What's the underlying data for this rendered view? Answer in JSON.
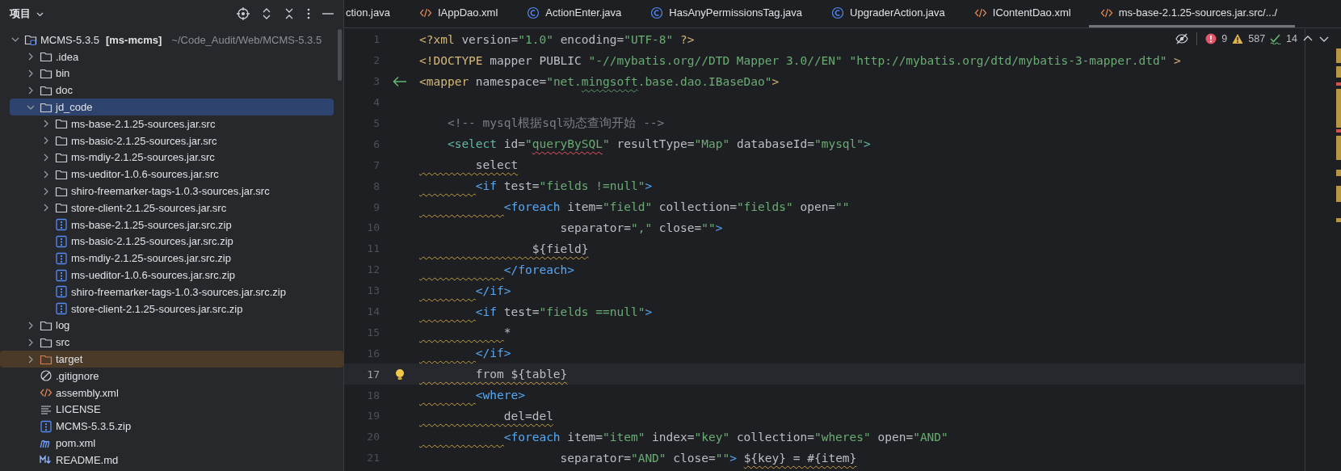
{
  "project": {
    "title": "项目",
    "tree": [
      {
        "kind": "module",
        "label": "MCMS-5.3.5",
        "suffix": "[ms-mcms]",
        "path": "~/Code_Audit/Web/MCMS-5.3.5",
        "expanded": true,
        "selected": false,
        "children": [
          {
            "kind": "folder",
            "label": ".idea",
            "expanded": false,
            "selected": false
          },
          {
            "kind": "folder",
            "label": "bin",
            "expanded": false,
            "selected": false
          },
          {
            "kind": "folder",
            "label": "doc",
            "expanded": false,
            "selected": false
          },
          {
            "kind": "folder",
            "label": "jd_code",
            "expanded": true,
            "selected": true,
            "children": [
              {
                "kind": "folder",
                "label": "ms-base-2.1.25-sources.jar.src",
                "expanded": false,
                "selected": false
              },
              {
                "kind": "folder",
                "label": "ms-basic-2.1.25-sources.jar.src",
                "expanded": false,
                "selected": false
              },
              {
                "kind": "folder",
                "label": "ms-mdiy-2.1.25-sources.jar.src",
                "expanded": false,
                "selected": false
              },
              {
                "kind": "folder",
                "label": "ms-ueditor-1.0.6-sources.jar.src",
                "expanded": false,
                "selected": false
              },
              {
                "kind": "folder",
                "label": "shiro-freemarker-tags-1.0.3-sources.jar.src",
                "expanded": false,
                "selected": false
              },
              {
                "kind": "folder",
                "label": "store-client-2.1.25-sources.jar.src",
                "expanded": false,
                "selected": false
              },
              {
                "kind": "zip",
                "label": "ms-base-2.1.25-sources.jar.src.zip",
                "selected": false
              },
              {
                "kind": "zip",
                "label": "ms-basic-2.1.25-sources.jar.src.zip",
                "selected": false
              },
              {
                "kind": "zip",
                "label": "ms-mdiy-2.1.25-sources.jar.src.zip",
                "selected": false
              },
              {
                "kind": "zip",
                "label": "ms-ueditor-1.0.6-sources.jar.src.zip",
                "selected": false
              },
              {
                "kind": "zip",
                "label": "shiro-freemarker-tags-1.0.3-sources.jar.src.zip",
                "selected": false
              },
              {
                "kind": "zip",
                "label": "store-client-2.1.25-sources.jar.src.zip",
                "selected": false
              }
            ]
          },
          {
            "kind": "folder",
            "label": "log",
            "expanded": false,
            "selected": false
          },
          {
            "kind": "folder",
            "label": "src",
            "expanded": false,
            "selected": false
          },
          {
            "kind": "excluded-folder",
            "label": "target",
            "expanded": false,
            "selected": false
          },
          {
            "kind": "ignore",
            "label": ".gitignore",
            "selected": false
          },
          {
            "kind": "xml",
            "label": "assembly.xml",
            "selected": false
          },
          {
            "kind": "text",
            "label": "LICENSE",
            "selected": false
          },
          {
            "kind": "zip",
            "label": "MCMS-5.3.5.zip",
            "selected": false
          },
          {
            "kind": "maven",
            "label": "pom.xml",
            "selected": false
          },
          {
            "kind": "markdown",
            "label": "README.md",
            "selected": false
          }
        ]
      }
    ]
  },
  "editor": {
    "tabs": [
      {
        "kind": "partial",
        "label": "ction.java",
        "selected": false
      },
      {
        "kind": "xml",
        "label": "IAppDao.xml",
        "selected": false
      },
      {
        "kind": "class",
        "label": "ActionEnter.java",
        "selected": false
      },
      {
        "kind": "class",
        "label": "HasAnyPermissionsTag.java",
        "selected": false
      },
      {
        "kind": "class",
        "label": "UpgraderAction.java",
        "selected": false
      },
      {
        "kind": "xml",
        "label": "IContentDao.xml",
        "selected": false
      },
      {
        "kind": "xml",
        "label": "ms-base-2.1.25-sources.jar.src/.../",
        "selected": true
      }
    ],
    "inspections": {
      "errors": "9",
      "warnings": "587",
      "weak_warnings": "14"
    },
    "lines": [
      {
        "kind": "plain",
        "number": "1",
        "current": false,
        "tokens": [
          {
            "kind": "prolog",
            "text": "<?xml "
          },
          {
            "kind": "plain",
            "text": "version="
          },
          {
            "kind": "value",
            "text": "\"1.0\" "
          },
          {
            "kind": "plain",
            "text": "encoding="
          },
          {
            "kind": "value",
            "text": "\"UTF-8\" "
          },
          {
            "kind": "prolog",
            "text": "?>"
          }
        ]
      },
      {
        "kind": "plain",
        "number": "2",
        "current": false,
        "tokens": [
          {
            "kind": "prolog",
            "text": "<!DOCTYPE "
          },
          {
            "kind": "plain",
            "text": "mapper PUBLIC "
          },
          {
            "kind": "value",
            "text": "\"-//mybatis.org//DTD Mapper 3.0//EN\" \"http://mybatis.org/dtd/mybatis-3-mapper.dtd\" "
          },
          {
            "kind": "prolog",
            "text": ">"
          }
        ]
      },
      {
        "kind": "arrow",
        "number": "3",
        "current": false,
        "tokens": [
          {
            "kind": "prolog",
            "text": "<mapper "
          },
          {
            "kind": "plain",
            "text": "namespace="
          },
          {
            "kind": "value",
            "text": "\"net."
          },
          {
            "kind": "value-typo",
            "text": "mingsoft"
          },
          {
            "kind": "value",
            "text": ".base.dao.IBaseDao\""
          },
          {
            "kind": "prolog",
            "text": ">"
          }
        ]
      },
      {
        "kind": "plain",
        "number": "4",
        "current": false
      },
      {
        "kind": "plain",
        "number": "5",
        "current": false,
        "indent_warning": false,
        "tokens": [
          {
            "kind": "comment",
            "text": "    <!-- mysql根据sql动态查询开始 -->"
          }
        ]
      },
      {
        "kind": "plain",
        "number": "6",
        "current": false,
        "indent_warning": false,
        "tokens": [
          {
            "kind": "select",
            "text": "    <select "
          },
          {
            "kind": "plain",
            "text": "id="
          },
          {
            "kind": "value",
            "text": "\""
          },
          {
            "kind": "value-error",
            "text": "queryBySQL"
          },
          {
            "kind": "value",
            "text": "\" "
          },
          {
            "kind": "plain",
            "text": "resultType="
          },
          {
            "kind": "value",
            "text": "\"Map\" "
          },
          {
            "kind": "plain",
            "text": "databaseId="
          },
          {
            "kind": "value",
            "text": "\"mysql\""
          },
          {
            "kind": "select",
            "text": ">"
          }
        ]
      },
      {
        "kind": "plain",
        "number": "7",
        "current": false,
        "indent_warning": true,
        "tokens": [
          {
            "kind": "plain-warning",
            "text": "        select"
          }
        ]
      },
      {
        "kind": "plain",
        "number": "8",
        "current": false,
        "indent_warning": true,
        "tokens": [
          {
            "kind": "tag",
            "text": "        <if "
          },
          {
            "kind": "plain",
            "text": "test="
          },
          {
            "kind": "value",
            "text": "\"fields !=null\""
          },
          {
            "kind": "tag",
            "text": ">"
          }
        ]
      },
      {
        "kind": "plain",
        "number": "9",
        "current": false,
        "indent_warning": true,
        "tokens": [
          {
            "kind": "tag",
            "text": "            <foreach "
          },
          {
            "kind": "plain",
            "text": "item="
          },
          {
            "kind": "value",
            "text": "\"field\" "
          },
          {
            "kind": "plain",
            "text": "collection="
          },
          {
            "kind": "value",
            "text": "\"fields\" "
          },
          {
            "kind": "plain",
            "text": "open="
          },
          {
            "kind": "value",
            "text": "\"\""
          }
        ]
      },
      {
        "kind": "plain",
        "number": "10",
        "current": false,
        "indent_warning": false,
        "tokens": [
          {
            "kind": "plain",
            "text": "                    separator="
          },
          {
            "kind": "value",
            "text": "\",\" "
          },
          {
            "kind": "plain",
            "text": "close="
          },
          {
            "kind": "value",
            "text": "\"\""
          },
          {
            "kind": "tag",
            "text": ">"
          }
        ]
      },
      {
        "kind": "plain",
        "number": "11",
        "current": false,
        "indent_warning": true,
        "tokens": [
          {
            "kind": "plain-warning",
            "text": "                ${field}"
          }
        ]
      },
      {
        "kind": "plain",
        "number": "12",
        "current": false,
        "indent_warning": true,
        "tokens": [
          {
            "kind": "tag",
            "text": "            </foreach>"
          }
        ]
      },
      {
        "kind": "plain",
        "number": "13",
        "current": false,
        "indent_warning": true,
        "tokens": [
          {
            "kind": "tag",
            "text": "        </if>"
          }
        ]
      },
      {
        "kind": "plain",
        "number": "14",
        "current": false,
        "indent_warning": true,
        "tokens": [
          {
            "kind": "tag",
            "text": "        <if "
          },
          {
            "kind": "plain",
            "text": "test="
          },
          {
            "kind": "value",
            "text": "\"fields ==null\""
          },
          {
            "kind": "tag",
            "text": ">"
          }
        ]
      },
      {
        "kind": "plain",
        "number": "15",
        "current": false,
        "indent_warning": true,
        "tokens": [
          {
            "kind": "plain",
            "text": "            *"
          }
        ]
      },
      {
        "kind": "plain",
        "number": "16",
        "current": false,
        "indent_warning": true,
        "tokens": [
          {
            "kind": "tag",
            "text": "        </if>"
          }
        ]
      },
      {
        "kind": "bulb",
        "number": "17",
        "current": true,
        "indent_warning": true,
        "tokens": [
          {
            "kind": "plain-warning",
            "text": "        from ${table}"
          }
        ]
      },
      {
        "kind": "plain",
        "number": "18",
        "current": false,
        "indent_warning": true,
        "tokens": [
          {
            "kind": "tag",
            "text": "        <where>"
          }
        ]
      },
      {
        "kind": "plain",
        "number": "19",
        "current": false,
        "indent_warning": true,
        "tokens": [
          {
            "kind": "plain-warning",
            "text": "            del=del"
          }
        ]
      },
      {
        "kind": "plain",
        "number": "20",
        "current": false,
        "indent_warning": true,
        "tokens": [
          {
            "kind": "tag",
            "text": "            <foreach "
          },
          {
            "kind": "plain",
            "text": "item="
          },
          {
            "kind": "value",
            "text": "\"item\" "
          },
          {
            "kind": "plain",
            "text": "index="
          },
          {
            "kind": "value",
            "text": "\"key\" "
          },
          {
            "kind": "plain",
            "text": "collection="
          },
          {
            "kind": "value",
            "text": "\"wheres\" "
          },
          {
            "kind": "plain",
            "text": "open="
          },
          {
            "kind": "value",
            "text": "\"AND\""
          }
        ]
      },
      {
        "kind": "plain",
        "number": "21",
        "current": false,
        "indent_warning": false,
        "tokens": [
          {
            "kind": "plain",
            "text": "                    separator="
          },
          {
            "kind": "value",
            "text": "\"AND\" "
          },
          {
            "kind": "plain",
            "text": "close="
          },
          {
            "kind": "value",
            "text": "\"\""
          },
          {
            "kind": "tag",
            "text": "> "
          },
          {
            "kind": "plain-warning",
            "text": "${key} = #{item}"
          }
        ]
      }
    ]
  }
}
